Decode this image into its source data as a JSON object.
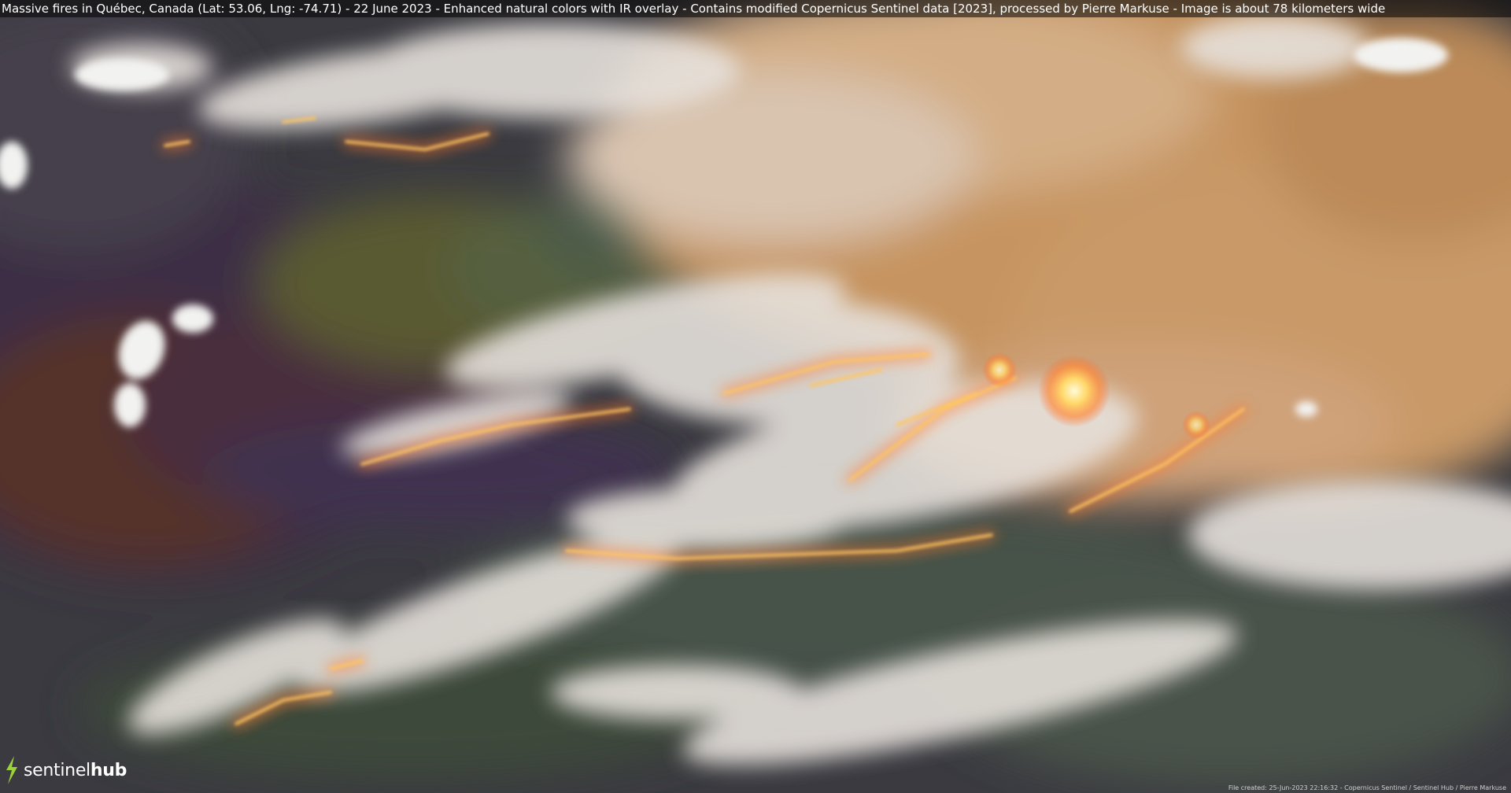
{
  "caption": "Massive fires in Québec, Canada (Lat: 53.06, Lng: -74.71) - 22 June 2023 - Enhanced natural colors with IR overlay - Contains modified Copernicus Sentinel data [2023], processed by Pierre Markuse - Image is about 78 kilometers wide",
  "logo": {
    "text_regular": "sentinel",
    "text_bold": "hub",
    "mark_color": "#9bd13b"
  },
  "credit": "File created: 25-Jun-2023 22:16:32 - Copernicus Sentinel / Sentinel Hub / Pierre Markuse",
  "colors": {
    "smoke_tan": "#c89a68",
    "smoke_white": "#e9e4e0",
    "burn_scar_purple": "#3e2a47",
    "burn_scar_red": "#5a2a22",
    "forest_green": "#4f5a3a",
    "fire_orange": "#ff9a3c",
    "fire_core": "#fff2b0"
  }
}
